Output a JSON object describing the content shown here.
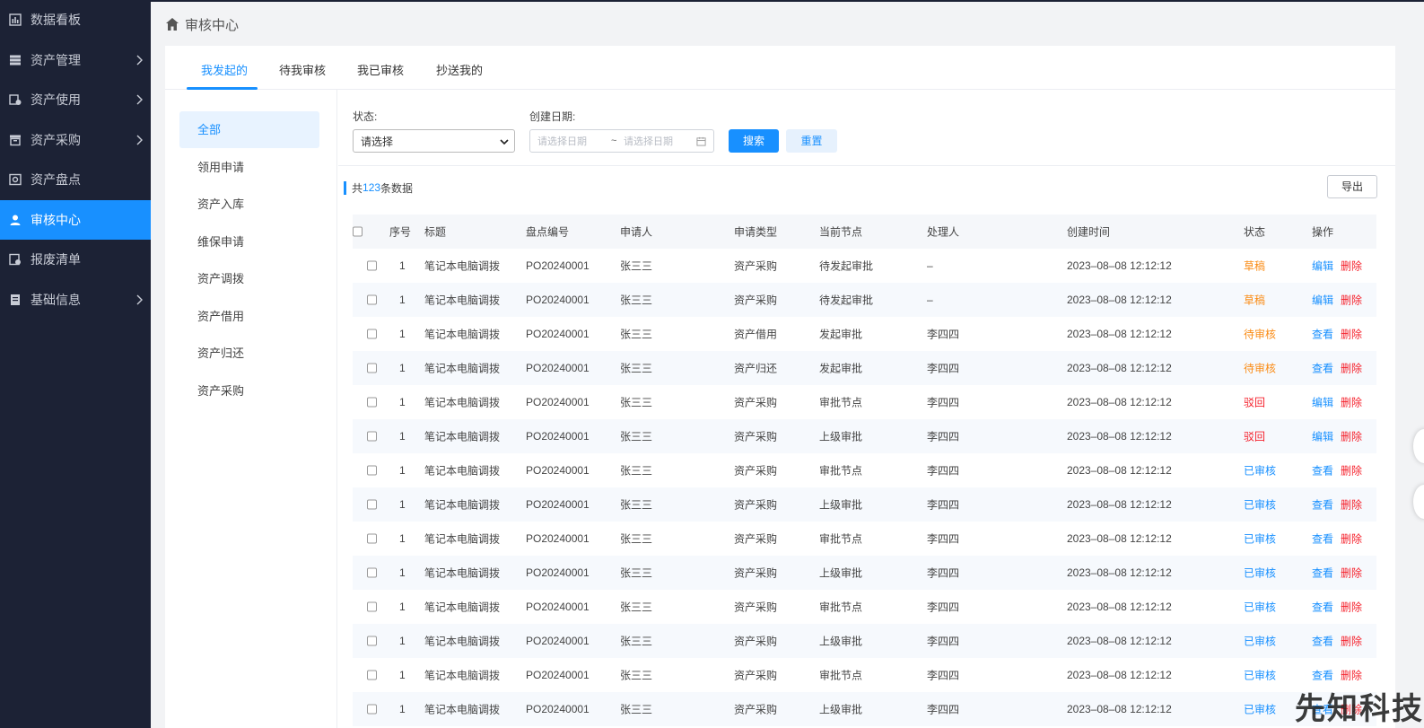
{
  "sidebar": {
    "items": [
      {
        "label": "数据看板",
        "icon": "chart-icon",
        "has_children": false,
        "active": false
      },
      {
        "label": "资产管理",
        "icon": "server-icon",
        "has_children": true,
        "active": false
      },
      {
        "label": "资产使用",
        "icon": "asset-use-icon",
        "has_children": true,
        "active": false
      },
      {
        "label": "资产采购",
        "icon": "box-icon",
        "has_children": true,
        "active": false
      },
      {
        "label": "资产盘点",
        "icon": "inventory-icon",
        "has_children": false,
        "active": false
      },
      {
        "label": "审核中心",
        "icon": "user-icon",
        "has_children": false,
        "active": true
      },
      {
        "label": "报废清单",
        "icon": "scrap-icon",
        "has_children": false,
        "active": false
      },
      {
        "label": "基础信息",
        "icon": "document-icon",
        "has_children": true,
        "active": false
      }
    ]
  },
  "breadcrumb": {
    "title": "审核中心"
  },
  "tabs": [
    {
      "label": "我发起的",
      "active": true
    },
    {
      "label": "待我审核",
      "active": false
    },
    {
      "label": "我已审核",
      "active": false
    },
    {
      "label": "抄送我的",
      "active": false
    }
  ],
  "categories": [
    {
      "label": "全部",
      "active": true
    },
    {
      "label": "领用申请",
      "active": false
    },
    {
      "label": "资产入库",
      "active": false
    },
    {
      "label": "维保申请",
      "active": false
    },
    {
      "label": "资产调拨",
      "active": false
    },
    {
      "label": "资产借用",
      "active": false
    },
    {
      "label": "资产归还",
      "active": false
    },
    {
      "label": "资产采购",
      "active": false
    }
  ],
  "filters": {
    "status_label": "状态:",
    "status_value": "请选择",
    "date_label": "创建日期:",
    "date_start_placeholder": "请选择日期",
    "date_separator": "~",
    "date_end_placeholder": "请选择日期",
    "search_label": "搜索",
    "reset_label": "重置"
  },
  "summary": {
    "prefix": "共",
    "count": "123",
    "suffix": "条数据"
  },
  "export_label": "导出",
  "table": {
    "headers": {
      "index": "序号",
      "title": "标题",
      "code": "盘点编号",
      "applicant": "申请人",
      "type": "申请类型",
      "node": "当前节点",
      "handler": "处理人",
      "created": "创建时间",
      "status": "状态",
      "actions": "操作"
    },
    "rows": [
      {
        "index": "1",
        "title": "笔记本电脑调拨",
        "code": "PO20240001",
        "applicant": "张三三",
        "type": "资产采购",
        "node": "待发起审批",
        "handler": "–",
        "created": "2023–08–08 12:12:12",
        "status": "草稿",
        "status_color": "#fa8c16",
        "action1": "编辑",
        "action2": "删除"
      },
      {
        "index": "1",
        "title": "笔记本电脑调拨",
        "code": "PO20240001",
        "applicant": "张三三",
        "type": "资产采购",
        "node": "待发起审批",
        "handler": "–",
        "created": "2023–08–08 12:12:12",
        "status": "草稿",
        "status_color": "#fa8c16",
        "action1": "编辑",
        "action2": "删除"
      },
      {
        "index": "1",
        "title": "笔记本电脑调拨",
        "code": "PO20240001",
        "applicant": "张三三",
        "type": "资产借用",
        "node": "发起审批",
        "handler": "李四四",
        "created": "2023–08–08 12:12:12",
        "status": "待审核",
        "status_color": "#fa8c16",
        "action1": "查看",
        "action2": "删除"
      },
      {
        "index": "1",
        "title": "笔记本电脑调拨",
        "code": "PO20240001",
        "applicant": "张三三",
        "type": "资产归还",
        "node": "发起审批",
        "handler": "李四四",
        "created": "2023–08–08 12:12:12",
        "status": "待审核",
        "status_color": "#fa8c16",
        "action1": "查看",
        "action2": "删除"
      },
      {
        "index": "1",
        "title": "笔记本电脑调拨",
        "code": "PO20240001",
        "applicant": "张三三",
        "type": "资产采购",
        "node": "审批节点",
        "handler": "李四四",
        "created": "2023–08–08 12:12:12",
        "status": "驳回",
        "status_color": "#f5222d",
        "action1": "编辑",
        "action2": "删除"
      },
      {
        "index": "1",
        "title": "笔记本电脑调拨",
        "code": "PO20240001",
        "applicant": "张三三",
        "type": "资产采购",
        "node": "上级审批",
        "handler": "李四四",
        "created": "2023–08–08 12:12:12",
        "status": "驳回",
        "status_color": "#f5222d",
        "action1": "编辑",
        "action2": "删除"
      },
      {
        "index": "1",
        "title": "笔记本电脑调拨",
        "code": "PO20240001",
        "applicant": "张三三",
        "type": "资产采购",
        "node": "审批节点",
        "handler": "李四四",
        "created": "2023–08–08 12:12:12",
        "status": "已审核",
        "status_color": "#1890ff",
        "action1": "查看",
        "action2": "删除"
      },
      {
        "index": "1",
        "title": "笔记本电脑调拨",
        "code": "PO20240001",
        "applicant": "张三三",
        "type": "资产采购",
        "node": "上级审批",
        "handler": "李四四",
        "created": "2023–08–08 12:12:12",
        "status": "已审核",
        "status_color": "#1890ff",
        "action1": "查看",
        "action2": "删除"
      },
      {
        "index": "1",
        "title": "笔记本电脑调拨",
        "code": "PO20240001",
        "applicant": "张三三",
        "type": "资产采购",
        "node": "审批节点",
        "handler": "李四四",
        "created": "2023–08–08 12:12:12",
        "status": "已审核",
        "status_color": "#1890ff",
        "action1": "查看",
        "action2": "删除"
      },
      {
        "index": "1",
        "title": "笔记本电脑调拨",
        "code": "PO20240001",
        "applicant": "张三三",
        "type": "资产采购",
        "node": "上级审批",
        "handler": "李四四",
        "created": "2023–08–08 12:12:12",
        "status": "已审核",
        "status_color": "#1890ff",
        "action1": "查看",
        "action2": "删除"
      },
      {
        "index": "1",
        "title": "笔记本电脑调拨",
        "code": "PO20240001",
        "applicant": "张三三",
        "type": "资产采购",
        "node": "审批节点",
        "handler": "李四四",
        "created": "2023–08–08 12:12:12",
        "status": "已审核",
        "status_color": "#1890ff",
        "action1": "查看",
        "action2": "删除"
      },
      {
        "index": "1",
        "title": "笔记本电脑调拨",
        "code": "PO20240001",
        "applicant": "张三三",
        "type": "资产采购",
        "node": "上级审批",
        "handler": "李四四",
        "created": "2023–08–08 12:12:12",
        "status": "已审核",
        "status_color": "#1890ff",
        "action1": "查看",
        "action2": "删除"
      },
      {
        "index": "1",
        "title": "笔记本电脑调拨",
        "code": "PO20240001",
        "applicant": "张三三",
        "type": "资产采购",
        "node": "审批节点",
        "handler": "李四四",
        "created": "2023–08–08 12:12:12",
        "status": "已审核",
        "status_color": "#1890ff",
        "action1": "查看",
        "action2": "删除"
      },
      {
        "index": "1",
        "title": "笔记本电脑调拨",
        "code": "PO20240001",
        "applicant": "张三三",
        "type": "资产采购",
        "node": "上级审批",
        "handler": "李四四",
        "created": "2023–08–08 12:12:12",
        "status": "已审核",
        "status_color": "#1890ff",
        "action1": "查看",
        "action2": "删除"
      }
    ]
  },
  "colors": {
    "accent": "#1890ff",
    "sidebar_bg": "#1c2235",
    "danger": "#f5222d",
    "warning": "#fa8c16"
  },
  "watermark": "先知科技"
}
